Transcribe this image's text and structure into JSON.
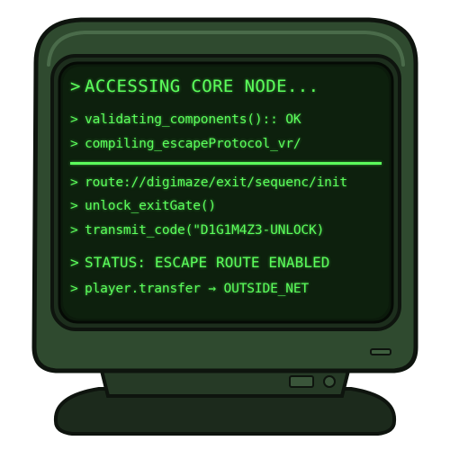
{
  "terminal": {
    "prompt_symbol": ">",
    "header": "ACCESSING CORE NODE...",
    "lines_top": [
      "validating_components():: OK",
      "compiling_escapeProtocol_vr/"
    ],
    "lines_bottom": [
      "route://digimaze/exit/sequenc/init",
      "unlock_exitGate()",
      "transmit_code(\"D1G1M4Z3-UNLOCK)"
    ],
    "status_label": "STATUS:",
    "status_value": "ESCAPE ROUTE ENABLED",
    "final_line": "player.transfer → OUTSIDE_NET"
  },
  "colors": {
    "text": "#5cff5c",
    "screen": "#0b1a0b",
    "bezel": "#2f4a2f",
    "bezel_dark": "#1d2e1d",
    "outline": "#0e140e"
  }
}
